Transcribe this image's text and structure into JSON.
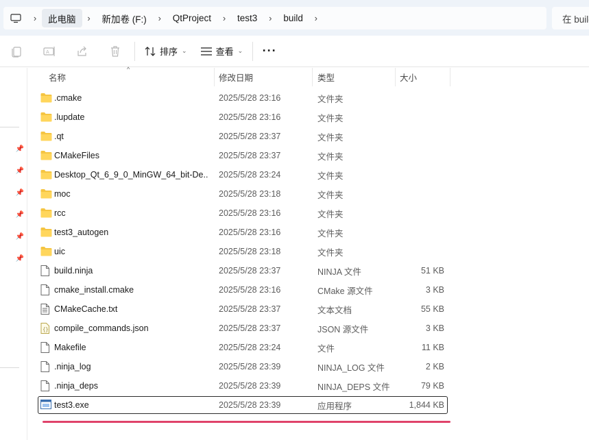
{
  "breadcrumb": [
    "此电脑",
    "新加卷 (F:)",
    "QtProject",
    "test3",
    "build"
  ],
  "search": {
    "placeholder": "在 build 中搜索"
  },
  "toolbar": {
    "sort_label": "排序",
    "view_label": "查看",
    "more_label": "···",
    "icons": [
      "copy-icon",
      "rename-icon",
      "share-icon",
      "delete-icon"
    ]
  },
  "columns": {
    "name": "名称",
    "date": "修改日期",
    "type": "类型",
    "size": "大小"
  },
  "files": [
    {
      "name": ".cmake",
      "date": "2025/5/28 23:16",
      "type": "文件夹",
      "size": "",
      "icon": "folder"
    },
    {
      "name": ".lupdate",
      "date": "2025/5/28 23:16",
      "type": "文件夹",
      "size": "",
      "icon": "folder"
    },
    {
      "name": ".qt",
      "date": "2025/5/28 23:37",
      "type": "文件夹",
      "size": "",
      "icon": "folder"
    },
    {
      "name": "CMakeFiles",
      "date": "2025/5/28 23:37",
      "type": "文件夹",
      "size": "",
      "icon": "folder"
    },
    {
      "name": "Desktop_Qt_6_9_0_MinGW_64_bit-De...",
      "date": "2025/5/28 23:24",
      "type": "文件夹",
      "size": "",
      "icon": "folder"
    },
    {
      "name": "moc",
      "date": "2025/5/28 23:18",
      "type": "文件夹",
      "size": "",
      "icon": "folder"
    },
    {
      "name": "rcc",
      "date": "2025/5/28 23:16",
      "type": "文件夹",
      "size": "",
      "icon": "folder"
    },
    {
      "name": "test3_autogen",
      "date": "2025/5/28 23:16",
      "type": "文件夹",
      "size": "",
      "icon": "folder"
    },
    {
      "name": "uic",
      "date": "2025/5/28 23:18",
      "type": "文件夹",
      "size": "",
      "icon": "folder"
    },
    {
      "name": "build.ninja",
      "date": "2025/5/28 23:37",
      "type": "NINJA 文件",
      "size": "51 KB",
      "icon": "file"
    },
    {
      "name": "cmake_install.cmake",
      "date": "2025/5/28 23:16",
      "type": "CMake 源文件",
      "size": "3 KB",
      "icon": "file"
    },
    {
      "name": "CMakeCache.txt",
      "date": "2025/5/28 23:37",
      "type": "文本文档",
      "size": "55 KB",
      "icon": "text"
    },
    {
      "name": "compile_commands.json",
      "date": "2025/5/28 23:37",
      "type": "JSON 源文件",
      "size": "3 KB",
      "icon": "json"
    },
    {
      "name": "Makefile",
      "date": "2025/5/28 23:24",
      "type": "文件",
      "size": "11 KB",
      "icon": "file"
    },
    {
      "name": ".ninja_log",
      "date": "2025/5/28 23:39",
      "type": "NINJA_LOG 文件",
      "size": "2 KB",
      "icon": "file"
    },
    {
      "name": ".ninja_deps",
      "date": "2025/5/28 23:39",
      "type": "NINJA_DEPS 文件",
      "size": "79 KB",
      "icon": "file"
    },
    {
      "name": "test3.exe",
      "date": "2025/5/28 23:39",
      "type": "应用程序",
      "size": "1,844 KB",
      "icon": "exe",
      "selected": true
    }
  ],
  "colors": {
    "folder": "#f5c542",
    "selection_border": "#2b2b2b",
    "highlight_underline": "#e0436a"
  }
}
